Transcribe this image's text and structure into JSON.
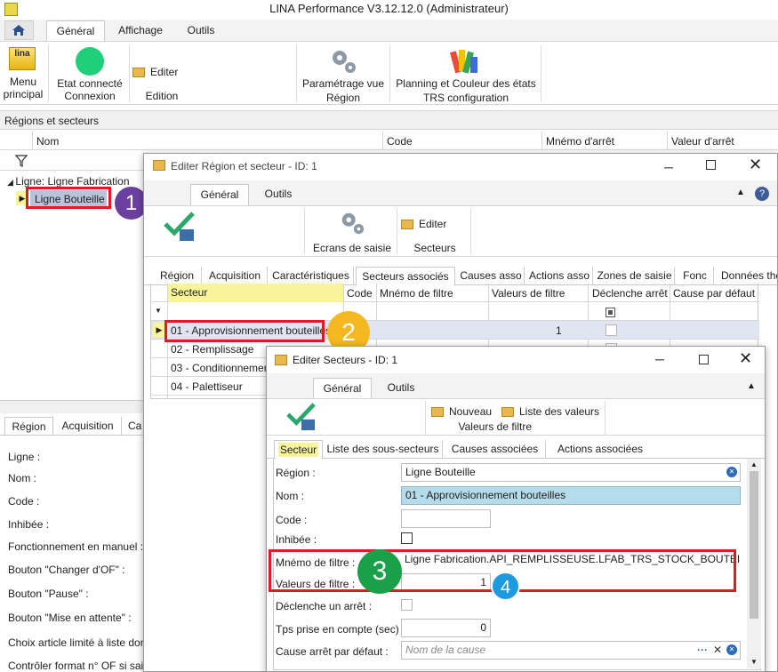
{
  "app": {
    "title": "LINA Performance  V3.12.12.0  (Administrateur)",
    "tabs": [
      "Général",
      "Affichage",
      "Outils"
    ],
    "ribbon": {
      "menu_label1": "Menu",
      "menu_label2": "principal",
      "connect_label1": "Etat connecté",
      "connect_label2": "Connexion",
      "edit_label": "Editer",
      "edit_group": "Edition",
      "param_label1": "Paramétrage vue",
      "param_label2": "Région",
      "planning_label1": "Planning et Couleur des états",
      "planning_label2": "TRS configuration"
    }
  },
  "regions_panel": {
    "title": "Régions et secteurs",
    "columns": [
      "Nom",
      "Code",
      "Mnémo d'arrêt",
      "Valeur d'arrêt"
    ],
    "tree_parent": "Ligne: Ligne Fabrication",
    "tree_child": "Ligne Bouteille"
  },
  "bottom_panel": {
    "tabs": [
      "Région",
      "Acquisition",
      "Ca"
    ],
    "fields": [
      "Ligne :",
      "Nom :",
      "Code :",
      "Inhibée :",
      "Fonctionnement en manuel :",
      "Bouton \"Changer d'OF\" :",
      "Bouton \"Pause\" :",
      "Bouton \"Mise en attente\" :",
      "Choix article limité à liste donn",
      "Contrôler format n° OF si saisie"
    ]
  },
  "region_window": {
    "title": "Editer Région et secteur - ID: 1",
    "tabs": [
      "Général",
      "Outils"
    ],
    "ecrans_label": "Ecrans de saisie",
    "editer_label": "Editer",
    "secteurs_group": "Secteurs",
    "subtabs": [
      "Région",
      "Acquisition",
      "Caractéristiques",
      "Secteurs associés",
      "Causes asso",
      "Actions asso",
      "Zones de saisie",
      "Fonc",
      "Données the"
    ],
    "grid": {
      "columns": [
        "Secteur",
        "Code",
        "Mnémo de filtre",
        "Valeurs de filtre",
        "Déclenche arrêt",
        "Cause par défaut"
      ],
      "rows": [
        {
          "secteur": "01 - Approvisionnement bouteilles",
          "valeur": "1"
        },
        {
          "secteur": "02 - Remplissage",
          "valeur": ""
        },
        {
          "secteur": "03 - Conditionnement",
          "valeur": ""
        },
        {
          "secteur": "04 - Palettiseur",
          "valeur": ""
        }
      ]
    }
  },
  "secteurs_window": {
    "title": "Editer Secteurs - ID: 1",
    "tabs": [
      "Général",
      "Outils"
    ],
    "nouveau_label": "Nouveau",
    "liste_label": "Liste des valeurs",
    "group_label": "Valeurs de filtre",
    "subtabs": [
      "Secteur",
      "Liste des sous-secteurs",
      "Causes associées",
      "Actions associées"
    ],
    "form": {
      "region_label": "Région :",
      "region_value": "Ligne Bouteille",
      "nom_label": "Nom :",
      "nom_value": "01 - Approvisionnement bouteilles",
      "code_label": "Code :",
      "code_value": "",
      "inhibee_label": "Inhibée :",
      "mnemo_label": "Mnémo de filtre :",
      "mnemo_value": "Ligne Fabrication.API_REMPLISSEUSE.LFAB_TRS_STOCK_BOUTEILLES_VIDE",
      "valeurs_label": "Valeurs de filtre :",
      "valeurs_value": "1",
      "declenche_label": "Déclenche un arrêt :",
      "tps_label": "Tps prise en compte (sec) :",
      "tps_value": "0",
      "cause_label": "Cause arrêt par défaut :",
      "cause_placeholder": "Nom de la cause"
    }
  },
  "callouts": [
    "1",
    "2",
    "3",
    "4"
  ],
  "colors": {
    "purple": "#6b3fa0",
    "orange": "#f5b820",
    "green": "#1aa049",
    "blue": "#1e9be0",
    "red": "#e01b24",
    "highlight": "#f7f49a"
  }
}
